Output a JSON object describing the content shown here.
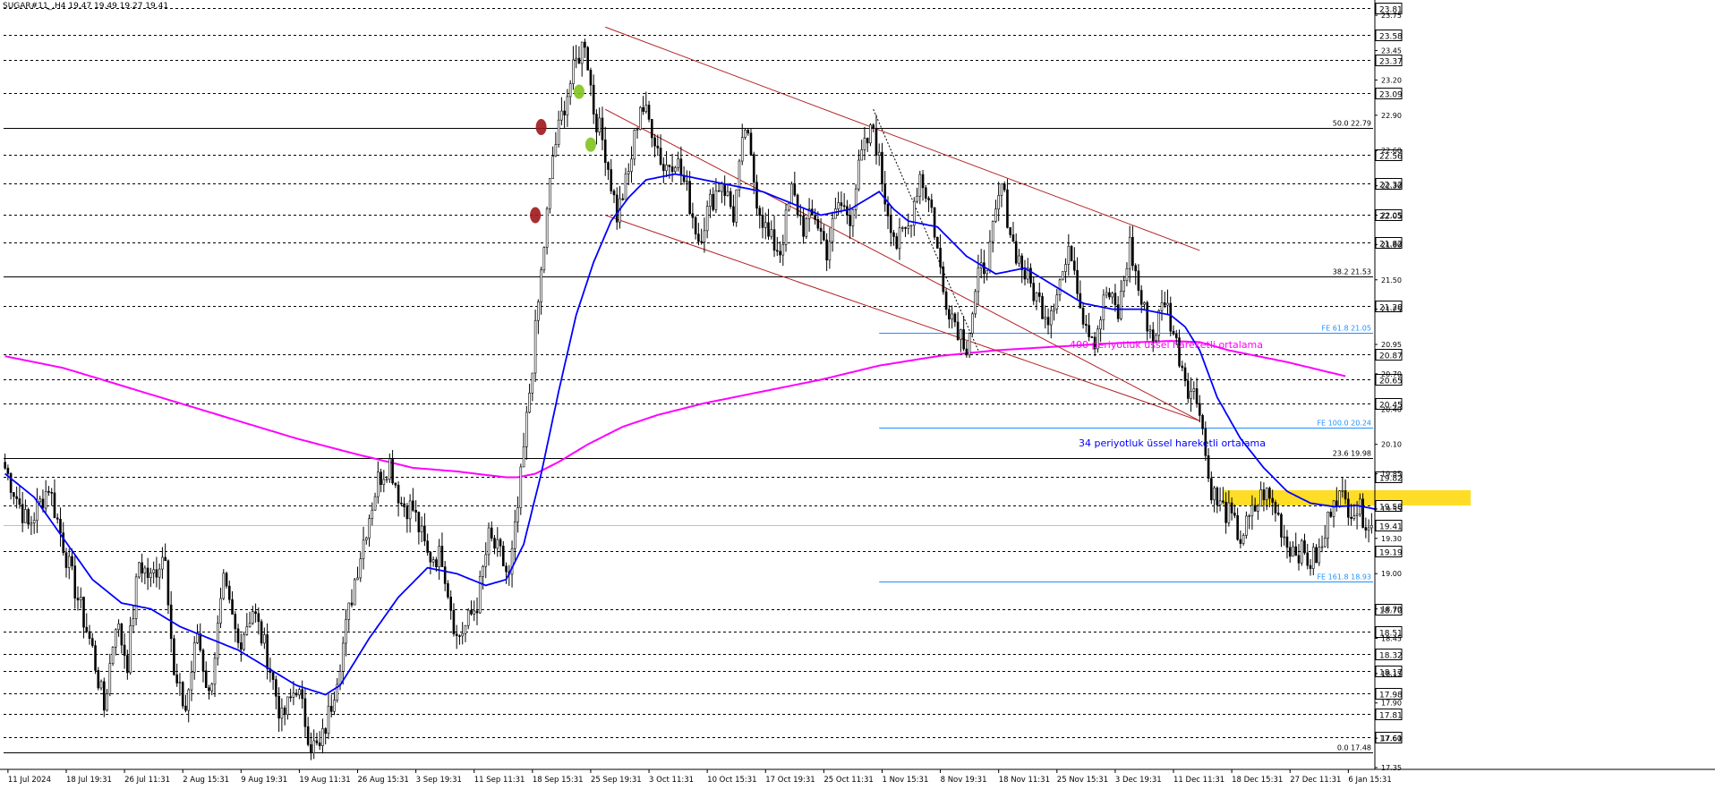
{
  "header": {
    "symbol": "SUGAR#11_,H4",
    "ohlc": "19.47 19.49 19.27 19.41"
  },
  "colors": {
    "background": "#ffffff",
    "grid": "#000000",
    "ema34": "#0000ff",
    "ema400": "#ff00ff",
    "fib_retracement": "#000000",
    "fib_extension": "#1e90ff",
    "channel": "#b22222",
    "zone": "#ffd700",
    "candle": "#000000",
    "marker_red": "#a0171b",
    "marker_green": "#7fc31c"
  },
  "chart_data": {
    "type": "candlestick",
    "y_min": 17.35,
    "y_max": 23.85,
    "price_axis_ticks": [
      "23.75",
      "23.45",
      "23.20",
      "22.90",
      "22.60",
      "22.30",
      "22.05",
      "21.80",
      "21.50",
      "21.25",
      "20.95",
      "20.70",
      "20.40",
      "20.10",
      "19.85",
      "19.55",
      "19.30",
      "19.00",
      "18.70",
      "18.45",
      "18.15",
      "17.90",
      "17.60",
      "17.35"
    ],
    "price_tick_values": [
      23.75,
      23.45,
      23.2,
      22.9,
      22.6,
      22.3,
      22.05,
      21.8,
      21.5,
      21.25,
      20.95,
      20.7,
      20.4,
      20.1,
      19.85,
      19.55,
      19.3,
      19.0,
      18.7,
      18.45,
      18.15,
      17.9,
      17.6,
      17.35
    ],
    "dashed_levels": [
      "23.81",
      "23.58",
      "23.37",
      "23.09",
      "22.56",
      "22.32",
      "22.05",
      "21.82",
      "21.28",
      "20.87",
      "20.65",
      "20.45",
      "19.82",
      "19.58",
      "19.19",
      "18.70",
      "18.51",
      "18.32",
      "18.17",
      "17.98",
      "17.81",
      "17.61"
    ],
    "dashed_level_values": [
      23.81,
      23.58,
      23.37,
      23.09,
      22.56,
      22.32,
      22.05,
      21.82,
      21.28,
      20.87,
      20.65,
      20.45,
      19.82,
      19.58,
      19.19,
      18.7,
      18.51,
      18.32,
      18.17,
      17.98,
      17.81,
      17.61
    ],
    "current_price": {
      "label": "19.41",
      "value": 19.41
    },
    "fib_retracement": [
      {
        "label": "50.0 22.79",
        "value": 22.79
      },
      {
        "label": "38.2 21.53",
        "value": 21.53
      },
      {
        "label": "23.6 19.98",
        "value": 19.98
      },
      {
        "label": "0.0 17.48",
        "value": 17.48
      }
    ],
    "fib_extension": [
      {
        "label": "FE 61.8 21.05",
        "value": 21.05
      },
      {
        "label": "FE 100.0 20.24",
        "value": 20.24
      },
      {
        "label": "FE 161.8 18.93",
        "value": 18.93
      }
    ],
    "annotations": {
      "ema400_text": "400 periyotluk üssel hareketli ortalama",
      "ema34_text": "34 periyotluk üssel hareketli ortalama"
    },
    "zone": {
      "bar_from": 418,
      "bar_to": 503,
      "price_low": 19.58,
      "price_high": 19.71
    },
    "time_axis": {
      "labels": [
        "11 Jul 2024",
        "18 Jul 19:31",
        "26 Jul 11:31",
        "2 Aug 15:31",
        "9 Aug 19:31",
        "19 Aug 11:31",
        "26 Aug 15:31",
        "3 Sep 19:31",
        "11 Sep 11:31",
        "18 Sep 15:31",
        "25 Sep 19:31",
        "3 Oct 11:31",
        "10 Oct 15:31",
        "17 Oct 19:31",
        "25 Oct 11:31",
        "1 Nov 15:31",
        "8 Nov 19:31",
        "18 Nov 11:31",
        "25 Nov 15:31",
        "3 Dec 19:31",
        "11 Dec 11:31",
        "18 Dec 15:31",
        "27 Dec 11:31",
        "6 Jan 15:31"
      ],
      "bar_index": [
        1,
        21,
        41,
        61,
        81,
        101,
        121,
        141,
        161,
        181,
        201,
        221,
        241,
        261,
        281,
        301,
        321,
        341,
        361,
        381,
        401,
        421,
        441,
        461
      ]
    },
    "total_bars": 470,
    "anchors": [
      [
        0,
        19.9
      ],
      [
        8,
        19.4
      ],
      [
        15,
        19.75
      ],
      [
        22,
        19.05
      ],
      [
        30,
        18.35
      ],
      [
        34,
        17.85
      ],
      [
        38,
        18.6
      ],
      [
        42,
        18.25
      ],
      [
        46,
        19.1
      ],
      [
        50,
        18.95
      ],
      [
        55,
        19.2
      ],
      [
        58,
        18.1
      ],
      [
        62,
        17.85
      ],
      [
        66,
        18.5
      ],
      [
        70,
        17.95
      ],
      [
        75,
        18.9
      ],
      [
        80,
        18.4
      ],
      [
        85,
        18.7
      ],
      [
        90,
        18.3
      ],
      [
        95,
        17.75
      ],
      [
        100,
        18.05
      ],
      [
        105,
        17.55
      ],
      [
        108,
        17.5
      ],
      [
        112,
        17.9
      ],
      [
        116,
        18.4
      ],
      [
        120,
        18.95
      ],
      [
        124,
        19.4
      ],
      [
        128,
        19.8
      ],
      [
        132,
        19.95
      ],
      [
        136,
        19.6
      ],
      [
        140,
        19.55
      ],
      [
        145,
        19.15
      ],
      [
        150,
        19.15
      ],
      [
        155,
        18.45
      ],
      [
        158,
        18.55
      ],
      [
        162,
        18.75
      ],
      [
        166,
        19.3
      ],
      [
        170,
        19.15
      ],
      [
        173,
        18.95
      ],
      [
        176,
        19.55
      ],
      [
        179,
        20.3
      ],
      [
        182,
        21.05
      ],
      [
        185,
        21.8
      ],
      [
        188,
        22.55
      ],
      [
        192,
        23.0
      ],
      [
        196,
        23.35
      ],
      [
        199,
        23.55
      ],
      [
        202,
        22.95
      ],
      [
        206,
        22.6
      ],
      [
        210,
        22.05
      ],
      [
        214,
        22.4
      ],
      [
        218,
        23.0
      ],
      [
        222,
        22.8
      ],
      [
        226,
        22.45
      ],
      [
        230,
        22.55
      ],
      [
        234,
        22.25
      ],
      [
        238,
        21.85
      ],
      [
        242,
        22.15
      ],
      [
        246,
        22.35
      ],
      [
        250,
        22.05
      ],
      [
        254,
        22.8
      ],
      [
        258,
        22.2
      ],
      [
        262,
        21.85
      ],
      [
        266,
        21.75
      ],
      [
        270,
        22.25
      ],
      [
        274,
        21.95
      ],
      [
        278,
        22.05
      ],
      [
        282,
        21.75
      ],
      [
        286,
        22.15
      ],
      [
        290,
        22.05
      ],
      [
        294,
        22.55
      ],
      [
        298,
        22.8
      ],
      [
        302,
        22.2
      ],
      [
        306,
        21.8
      ],
      [
        310,
        21.95
      ],
      [
        314,
        22.4
      ],
      [
        318,
        22.1
      ],
      [
        322,
        21.4
      ],
      [
        326,
        21.15
      ],
      [
        330,
        20.95
      ],
      [
        334,
        21.5
      ],
      [
        338,
        21.75
      ],
      [
        342,
        22.3
      ],
      [
        346,
        21.8
      ],
      [
        350,
        21.55
      ],
      [
        354,
        21.35
      ],
      [
        358,
        21.2
      ],
      [
        362,
        21.5
      ],
      [
        366,
        21.75
      ],
      [
        370,
        21.2
      ],
      [
        374,
        21.0
      ],
      [
        378,
        21.4
      ],
      [
        382,
        21.2
      ],
      [
        386,
        21.8
      ],
      [
        390,
        21.3
      ],
      [
        394,
        21.0
      ],
      [
        398,
        21.35
      ],
      [
        402,
        20.95
      ],
      [
        406,
        20.6
      ],
      [
        410,
        20.45
      ],
      [
        413,
        19.8
      ],
      [
        416,
        19.6
      ],
      [
        420,
        19.5
      ],
      [
        424,
        19.3
      ],
      [
        428,
        19.5
      ],
      [
        432,
        19.7
      ],
      [
        436,
        19.55
      ],
      [
        440,
        19.25
      ],
      [
        444,
        19.2
      ],
      [
        448,
        19.1
      ],
      [
        452,
        19.2
      ],
      [
        456,
        19.7
      ],
      [
        460,
        19.6
      ],
      [
        464,
        19.55
      ],
      [
        468,
        19.45
      ],
      [
        470,
        19.41
      ]
    ],
    "ema34_anchors": [
      [
        0,
        19.85
      ],
      [
        10,
        19.65
      ],
      [
        20,
        19.3
      ],
      [
        30,
        18.95
      ],
      [
        40,
        18.75
      ],
      [
        50,
        18.7
      ],
      [
        60,
        18.55
      ],
      [
        70,
        18.45
      ],
      [
        80,
        18.35
      ],
      [
        90,
        18.2
      ],
      [
        100,
        18.05
      ],
      [
        110,
        17.97
      ],
      [
        115,
        18.05
      ],
      [
        125,
        18.45
      ],
      [
        135,
        18.8
      ],
      [
        145,
        19.05
      ],
      [
        155,
        19.0
      ],
      [
        165,
        18.9
      ],
      [
        172,
        18.95
      ],
      [
        178,
        19.25
      ],
      [
        184,
        19.85
      ],
      [
        190,
        20.55
      ],
      [
        196,
        21.2
      ],
      [
        202,
        21.65
      ],
      [
        208,
        22.0
      ],
      [
        214,
        22.2
      ],
      [
        220,
        22.35
      ],
      [
        230,
        22.4
      ],
      [
        240,
        22.35
      ],
      [
        250,
        22.3
      ],
      [
        260,
        22.25
      ],
      [
        270,
        22.15
      ],
      [
        280,
        22.05
      ],
      [
        290,
        22.1
      ],
      [
        300,
        22.25
      ],
      [
        305,
        22.1
      ],
      [
        310,
        22.0
      ],
      [
        320,
        21.95
      ],
      [
        330,
        21.7
      ],
      [
        340,
        21.55
      ],
      [
        350,
        21.6
      ],
      [
        360,
        21.45
      ],
      [
        370,
        21.3
      ],
      [
        380,
        21.25
      ],
      [
        390,
        21.25
      ],
      [
        400,
        21.2
      ],
      [
        405,
        21.1
      ],
      [
        410,
        20.9
      ],
      [
        416,
        20.5
      ],
      [
        424,
        20.15
      ],
      [
        432,
        19.9
      ],
      [
        440,
        19.7
      ],
      [
        448,
        19.6
      ],
      [
        456,
        19.57
      ],
      [
        464,
        19.58
      ],
      [
        470,
        19.55
      ]
    ],
    "ema400_anchors": [
      [
        0,
        20.85
      ],
      [
        20,
        20.75
      ],
      [
        40,
        20.6
      ],
      [
        60,
        20.45
      ],
      [
        80,
        20.3
      ],
      [
        100,
        20.15
      ],
      [
        120,
        20.02
      ],
      [
        140,
        19.9
      ],
      [
        155,
        19.87
      ],
      [
        165,
        19.84
      ],
      [
        172,
        19.82
      ],
      [
        176,
        19.82
      ],
      [
        182,
        19.85
      ],
      [
        190,
        19.95
      ],
      [
        200,
        20.1
      ],
      [
        212,
        20.25
      ],
      [
        224,
        20.35
      ],
      [
        240,
        20.45
      ],
      [
        260,
        20.55
      ],
      [
        280,
        20.65
      ],
      [
        300,
        20.77
      ],
      [
        320,
        20.85
      ],
      [
        340,
        20.9
      ],
      [
        360,
        20.93
      ],
      [
        380,
        20.96
      ],
      [
        390,
        20.97
      ],
      [
        400,
        20.98
      ],
      [
        410,
        20.97
      ],
      [
        420,
        20.9
      ],
      [
        440,
        20.8
      ],
      [
        460,
        20.68
      ]
    ],
    "channel": [
      {
        "from": [
          206,
          23.65
        ],
        "to": [
          410,
          21.75
        ]
      },
      {
        "from": [
          206,
          22.95
        ],
        "to": [
          410,
          20.3
        ]
      },
      {
        "from": [
          206,
          22.05
        ],
        "to": [
          410,
          20.3
        ]
      }
    ],
    "zigzag": [
      [
        298,
        22.95
      ],
      [
        318,
        21.8
      ],
      [
        334,
        20.9
      ]
    ],
    "markers": [
      {
        "bar": 197,
        "price": 23.1,
        "color": "green"
      },
      {
        "bar": 201,
        "price": 22.65,
        "color": "green"
      },
      {
        "bar": 184,
        "price": 22.8,
        "color": "red"
      },
      {
        "bar": 182,
        "price": 22.05,
        "color": "red"
      }
    ]
  }
}
